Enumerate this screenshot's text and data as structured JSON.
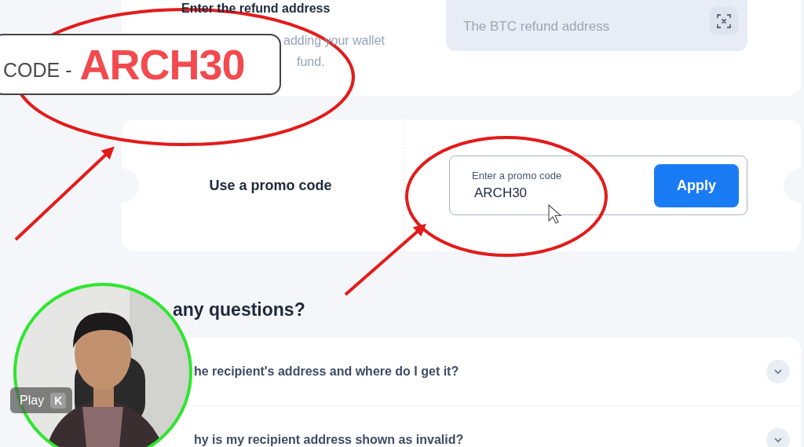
{
  "refund": {
    "title": "Enter the refund address",
    "hint_lines": [
      "adding your wallet",
      "fund."
    ],
    "field": {
      "placeholder": "The BTC refund address"
    }
  },
  "promo": {
    "title": "Use a promo code",
    "field": {
      "label": "Enter a promo code",
      "value": "ARCH30"
    },
    "button": "Apply"
  },
  "faq": {
    "heading": "any questions?",
    "items": [
      {
        "question": "he recipient's address and where do I get it?",
        "expanded": false
      },
      {
        "question": "hy is my recipient address shown as invalid?",
        "expanded": false
      }
    ]
  },
  "overlay_caption": {
    "prefix": "CODE -",
    "code": "ARCH30"
  },
  "video_controls": {
    "tooltip": "Play",
    "shortcut": "K"
  }
}
